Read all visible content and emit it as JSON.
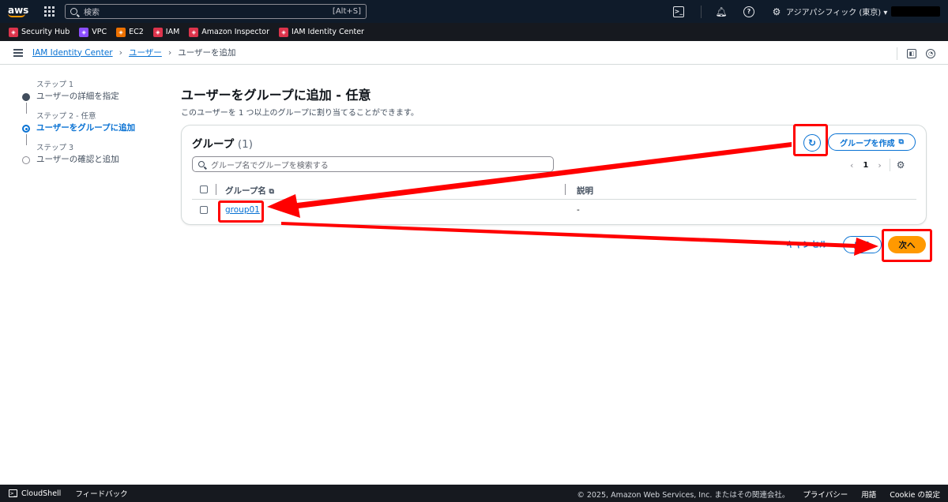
{
  "topnav": {
    "logo": "aws",
    "search_placeholder": "検索",
    "search_shortcut": "[Alt+S]",
    "region": "アジアパシフィック (東京) ▾"
  },
  "favorites": [
    {
      "label": "Security Hub",
      "color": "#dd344c",
      "icon": "security-hub-icon"
    },
    {
      "label": "VPC",
      "color": "#8c4fff",
      "icon": "vpc-icon"
    },
    {
      "label": "EC2",
      "color": "#ed7100",
      "icon": "ec2-icon"
    },
    {
      "label": "IAM",
      "color": "#dd344c",
      "icon": "iam-icon"
    },
    {
      "label": "Amazon Inspector",
      "color": "#dd344c",
      "icon": "inspector-icon"
    },
    {
      "label": "IAM Identity Center",
      "color": "#dd344c",
      "icon": "identity-center-icon"
    }
  ],
  "breadcrumb": {
    "items": [
      "IAM Identity Center",
      "ユーザー"
    ],
    "current": "ユーザーを追加"
  },
  "steps": [
    {
      "label": "ステップ 1",
      "title": "ユーザーの詳細を指定",
      "state": "done"
    },
    {
      "label": "ステップ 2 - 任意",
      "title": "ユーザーをグループに追加",
      "state": "current"
    },
    {
      "label": "ステップ 3",
      "title": "ユーザーの確認と追加",
      "state": "todo"
    }
  ],
  "main": {
    "title": "ユーザーをグループに追加 - 任意",
    "description": "このユーザーを 1 つ以上のグループに割り当てることができます。"
  },
  "groups_panel": {
    "title": "グループ",
    "count": "(1)",
    "create_label": "グループを作成",
    "filter_placeholder": "グループ名でグループを検索する",
    "page": "1",
    "columns": [
      "グループ名",
      "説明"
    ],
    "rows": [
      {
        "name": "group01",
        "description": "-"
      }
    ]
  },
  "actions": {
    "cancel": "キャンセル",
    "back": "戻る",
    "next": "次へ"
  },
  "footer": {
    "cloudshell": "CloudShell",
    "feedback": "フィードバック",
    "copyright": "© 2025, Amazon Web Services, Inc. またはその関連会社。",
    "privacy": "プライバシー",
    "terms": "用語",
    "cookies": "Cookie の設定"
  },
  "colors": {
    "nav_bg": "#0f1b2a",
    "link": "#0972d3",
    "primary": "#ff9900",
    "annotation": "#ff0000"
  }
}
